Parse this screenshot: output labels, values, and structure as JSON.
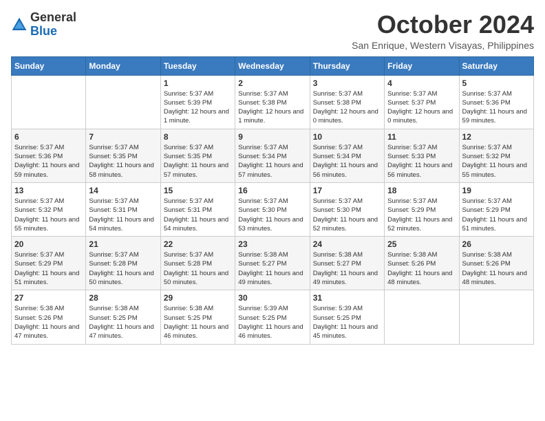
{
  "header": {
    "logo": {
      "general": "General",
      "blue": "Blue"
    },
    "month_year": "October 2024",
    "location": "San Enrique, Western Visayas, Philippines"
  },
  "days_of_week": [
    "Sunday",
    "Monday",
    "Tuesday",
    "Wednesday",
    "Thursday",
    "Friday",
    "Saturday"
  ],
  "weeks": [
    [
      {
        "day": "",
        "sunrise": "",
        "sunset": "",
        "daylight": ""
      },
      {
        "day": "",
        "sunrise": "",
        "sunset": "",
        "daylight": ""
      },
      {
        "day": "1",
        "sunrise": "Sunrise: 5:37 AM",
        "sunset": "Sunset: 5:39 PM",
        "daylight": "Daylight: 12 hours and 1 minute."
      },
      {
        "day": "2",
        "sunrise": "Sunrise: 5:37 AM",
        "sunset": "Sunset: 5:38 PM",
        "daylight": "Daylight: 12 hours and 1 minute."
      },
      {
        "day": "3",
        "sunrise": "Sunrise: 5:37 AM",
        "sunset": "Sunset: 5:38 PM",
        "daylight": "Daylight: 12 hours and 0 minutes."
      },
      {
        "day": "4",
        "sunrise": "Sunrise: 5:37 AM",
        "sunset": "Sunset: 5:37 PM",
        "daylight": "Daylight: 12 hours and 0 minutes."
      },
      {
        "day": "5",
        "sunrise": "Sunrise: 5:37 AM",
        "sunset": "Sunset: 5:36 PM",
        "daylight": "Daylight: 11 hours and 59 minutes."
      }
    ],
    [
      {
        "day": "6",
        "sunrise": "Sunrise: 5:37 AM",
        "sunset": "Sunset: 5:36 PM",
        "daylight": "Daylight: 11 hours and 59 minutes."
      },
      {
        "day": "7",
        "sunrise": "Sunrise: 5:37 AM",
        "sunset": "Sunset: 5:35 PM",
        "daylight": "Daylight: 11 hours and 58 minutes."
      },
      {
        "day": "8",
        "sunrise": "Sunrise: 5:37 AM",
        "sunset": "Sunset: 5:35 PM",
        "daylight": "Daylight: 11 hours and 57 minutes."
      },
      {
        "day": "9",
        "sunrise": "Sunrise: 5:37 AM",
        "sunset": "Sunset: 5:34 PM",
        "daylight": "Daylight: 11 hours and 57 minutes."
      },
      {
        "day": "10",
        "sunrise": "Sunrise: 5:37 AM",
        "sunset": "Sunset: 5:34 PM",
        "daylight": "Daylight: 11 hours and 56 minutes."
      },
      {
        "day": "11",
        "sunrise": "Sunrise: 5:37 AM",
        "sunset": "Sunset: 5:33 PM",
        "daylight": "Daylight: 11 hours and 56 minutes."
      },
      {
        "day": "12",
        "sunrise": "Sunrise: 5:37 AM",
        "sunset": "Sunset: 5:32 PM",
        "daylight": "Daylight: 11 hours and 55 minutes."
      }
    ],
    [
      {
        "day": "13",
        "sunrise": "Sunrise: 5:37 AM",
        "sunset": "Sunset: 5:32 PM",
        "daylight": "Daylight: 11 hours and 55 minutes."
      },
      {
        "day": "14",
        "sunrise": "Sunrise: 5:37 AM",
        "sunset": "Sunset: 5:31 PM",
        "daylight": "Daylight: 11 hours and 54 minutes."
      },
      {
        "day": "15",
        "sunrise": "Sunrise: 5:37 AM",
        "sunset": "Sunset: 5:31 PM",
        "daylight": "Daylight: 11 hours and 54 minutes."
      },
      {
        "day": "16",
        "sunrise": "Sunrise: 5:37 AM",
        "sunset": "Sunset: 5:30 PM",
        "daylight": "Daylight: 11 hours and 53 minutes."
      },
      {
        "day": "17",
        "sunrise": "Sunrise: 5:37 AM",
        "sunset": "Sunset: 5:30 PM",
        "daylight": "Daylight: 11 hours and 52 minutes."
      },
      {
        "day": "18",
        "sunrise": "Sunrise: 5:37 AM",
        "sunset": "Sunset: 5:29 PM",
        "daylight": "Daylight: 11 hours and 52 minutes."
      },
      {
        "day": "19",
        "sunrise": "Sunrise: 5:37 AM",
        "sunset": "Sunset: 5:29 PM",
        "daylight": "Daylight: 11 hours and 51 minutes."
      }
    ],
    [
      {
        "day": "20",
        "sunrise": "Sunrise: 5:37 AM",
        "sunset": "Sunset: 5:29 PM",
        "daylight": "Daylight: 11 hours and 51 minutes."
      },
      {
        "day": "21",
        "sunrise": "Sunrise: 5:37 AM",
        "sunset": "Sunset: 5:28 PM",
        "daylight": "Daylight: 11 hours and 50 minutes."
      },
      {
        "day": "22",
        "sunrise": "Sunrise: 5:37 AM",
        "sunset": "Sunset: 5:28 PM",
        "daylight": "Daylight: 11 hours and 50 minutes."
      },
      {
        "day": "23",
        "sunrise": "Sunrise: 5:38 AM",
        "sunset": "Sunset: 5:27 PM",
        "daylight": "Daylight: 11 hours and 49 minutes."
      },
      {
        "day": "24",
        "sunrise": "Sunrise: 5:38 AM",
        "sunset": "Sunset: 5:27 PM",
        "daylight": "Daylight: 11 hours and 49 minutes."
      },
      {
        "day": "25",
        "sunrise": "Sunrise: 5:38 AM",
        "sunset": "Sunset: 5:26 PM",
        "daylight": "Daylight: 11 hours and 48 minutes."
      },
      {
        "day": "26",
        "sunrise": "Sunrise: 5:38 AM",
        "sunset": "Sunset: 5:26 PM",
        "daylight": "Daylight: 11 hours and 48 minutes."
      }
    ],
    [
      {
        "day": "27",
        "sunrise": "Sunrise: 5:38 AM",
        "sunset": "Sunset: 5:26 PM",
        "daylight": "Daylight: 11 hours and 47 minutes."
      },
      {
        "day": "28",
        "sunrise": "Sunrise: 5:38 AM",
        "sunset": "Sunset: 5:25 PM",
        "daylight": "Daylight: 11 hours and 47 minutes."
      },
      {
        "day": "29",
        "sunrise": "Sunrise: 5:38 AM",
        "sunset": "Sunset: 5:25 PM",
        "daylight": "Daylight: 11 hours and 46 minutes."
      },
      {
        "day": "30",
        "sunrise": "Sunrise: 5:39 AM",
        "sunset": "Sunset: 5:25 PM",
        "daylight": "Daylight: 11 hours and 46 minutes."
      },
      {
        "day": "31",
        "sunrise": "Sunrise: 5:39 AM",
        "sunset": "Sunset: 5:25 PM",
        "daylight": "Daylight: 11 hours and 45 minutes."
      },
      {
        "day": "",
        "sunrise": "",
        "sunset": "",
        "daylight": ""
      },
      {
        "day": "",
        "sunrise": "",
        "sunset": "",
        "daylight": ""
      }
    ]
  ]
}
